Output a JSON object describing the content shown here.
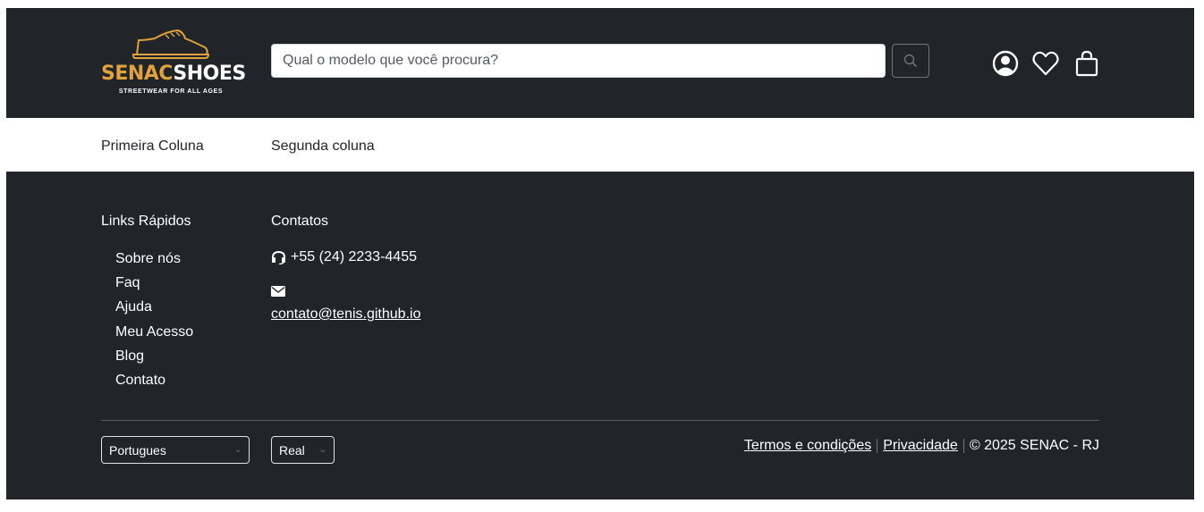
{
  "header": {
    "logo": {
      "part1": "SENAC",
      "part2": "SHOES",
      "tagline": "STREETWEAR FOR ALL AGES"
    },
    "search": {
      "placeholder": "Qual o modelo que você procura?",
      "value": ""
    },
    "icons": [
      "search-icon",
      "user-circle-icon",
      "heart-icon",
      "shopping-bag-icon"
    ],
    "accent_color": "#e0a23c",
    "background_color": "#212529"
  },
  "columns": {
    "first": "Primeira Coluna",
    "second": "Segunda coluna"
  },
  "footer": {
    "links_title": "Links Rápidos",
    "links": [
      "Sobre nós",
      "Faq",
      "Ajuda",
      "Meu Acesso",
      "Blog",
      "Contato"
    ],
    "contacts_title": "Contatos",
    "phone": "+55 (24) 2233-4455",
    "email": "contato@tenis.github.io",
    "language_select": "Portugues",
    "currency_select": "Real",
    "terms_link": "Termos e condições",
    "privacy_link": "Privacidade",
    "copyright": "© 2025 SENAC - RJ"
  }
}
